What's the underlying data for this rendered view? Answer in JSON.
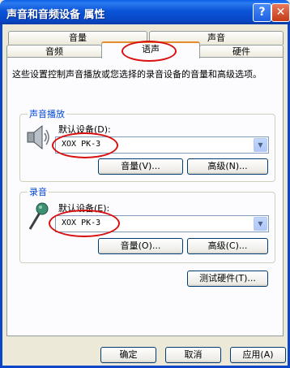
{
  "window": {
    "title": "声音和音频设备 属性",
    "help_glyph": "?",
    "close_glyph": "✕"
  },
  "tabs": {
    "row1": [
      "音量",
      "声音"
    ],
    "row2": [
      "音频",
      "语声",
      "硬件"
    ],
    "selected": "语声"
  },
  "description": "这些设置控制声音播放或您选择的录音设备的音量和高级选项。",
  "playback": {
    "group_label": "声音播放",
    "device_label": "默认设备(D):",
    "device_value": "XOX PK-3",
    "volume_button": "音量(V)...",
    "advanced_button": "高级(N)..."
  },
  "recording": {
    "group_label": "录音",
    "device_label": "默认设备(E):",
    "device_value": "XOX PK-3",
    "volume_button": "音量(O)...",
    "advanced_button": "高级(C)..."
  },
  "test_hardware_button": "测试硬件(T)...",
  "footer": {
    "ok": "确定",
    "cancel": "取消",
    "apply": "应用(A)"
  },
  "icons": {
    "playback": "speaker-icon",
    "recording": "microphone-icon",
    "dropdown": "chevron-down-icon"
  },
  "colors": {
    "titlebar": "#0a54d8",
    "group_label": "#0046d5",
    "annotation": "#d81010",
    "selected_tab_accent": "#e68b2c"
  }
}
